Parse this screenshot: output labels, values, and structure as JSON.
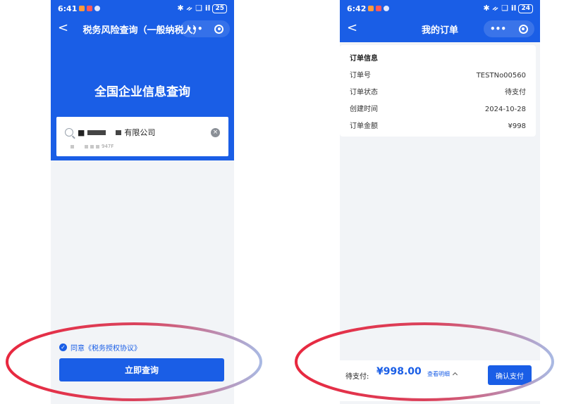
{
  "colors": {
    "brand_blue": "#1a5ee6",
    "page_background": "#f2f4f7",
    "annotation_red": "#e8283f",
    "annotation_lilac": "#a9b9e3"
  },
  "left_screen": {
    "status_bar": {
      "time": "6:41",
      "battery": "25",
      "signal": "✱ ᨀ ❑ il"
    },
    "nav": {
      "title": "税务风险查询（一般纳税人）",
      "back_label": "<",
      "more_label": "•••"
    },
    "hero_title": "全国企业信息查询",
    "search": {
      "value_prefix": "■",
      "value_suffix": "有限公司",
      "clear_label": "×",
      "suggestion_suffix": "947F"
    },
    "agreement": {
      "check_label": "✓",
      "text": "同意《税务授权协议》"
    },
    "query_button": "立即查询"
  },
  "right_screen": {
    "status_bar": {
      "time": "6:42",
      "battery": "24",
      "signal": "✱ ᨀ ❑ il"
    },
    "nav": {
      "title": "我的订单",
      "back_label": "<",
      "more_label": "•••"
    },
    "order_info": {
      "title": "订单信息",
      "rows": [
        {
          "label": "订单号",
          "value": "TESTNo00560"
        },
        {
          "label": "订单状态",
          "value": "待支付"
        },
        {
          "label": "创建时间",
          "value": "2024-10-28"
        },
        {
          "label": "订单金额",
          "value": "¥998"
        }
      ]
    },
    "pay_bar": {
      "status": "待支付:",
      "amount": "¥998.00",
      "detail_link": "查看明细",
      "confirm_button": "确认支付"
    }
  }
}
